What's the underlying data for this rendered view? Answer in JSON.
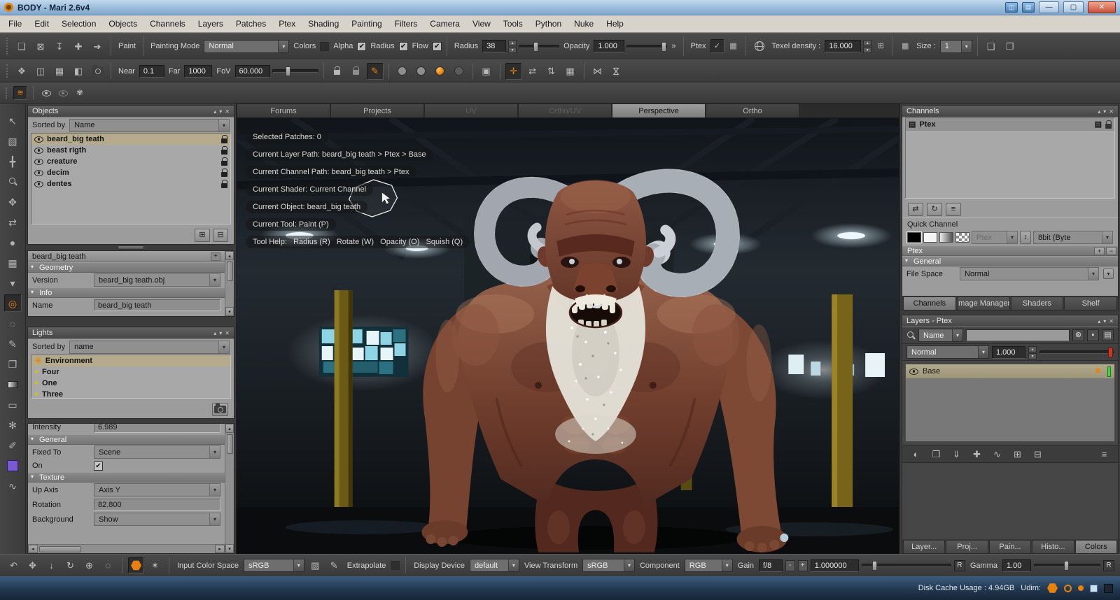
{
  "titlebar": {
    "title": "BODY - Mari 2.6v4"
  },
  "menubar": {
    "items": [
      "File",
      "Edit",
      "Selection",
      "Objects",
      "Channels",
      "Layers",
      "Patches",
      "Ptex",
      "Shading",
      "Painting",
      "Filters",
      "Camera",
      "View",
      "Tools",
      "Python",
      "Nuke",
      "Help"
    ]
  },
  "toolbar_paint": {
    "paint": "Paint",
    "painting_mode": "Painting Mode",
    "painting_mode_value": "Normal",
    "colors": "Colors",
    "alpha": "Alpha",
    "radius_toggle": "Radius",
    "flow": "Flow",
    "radius": "Radius",
    "radius_value": "38",
    "opacity": "Opacity",
    "opacity_value": "1.000",
    "overflow": "»",
    "ptex": "Ptex",
    "texel_density": "Texel density :",
    "texel_density_value": "16.000",
    "size": "Size :",
    "size_value": "1"
  },
  "toolbar_view": {
    "near": "Near",
    "near_value": "0.1",
    "far": "Far",
    "far_value": "1000",
    "fov": "FoV",
    "fov_value": "60.000"
  },
  "objects_panel": {
    "title": "Objects",
    "sorted_by": "Sorted by",
    "sort_value": "Name",
    "items": [
      {
        "name": "beard_big teath",
        "selected": true
      },
      {
        "name": "beast rigth"
      },
      {
        "name": "creature"
      },
      {
        "name": "decim"
      },
      {
        "name": "dentes"
      }
    ]
  },
  "object_props": {
    "title": "beard_big teath",
    "geometry": "Geometry",
    "version": "Version",
    "version_value": "beard_big teath.obj",
    "info": "Info",
    "name": "Name",
    "name_value": "beard_big teath"
  },
  "lights_panel": {
    "title": "Lights",
    "sorted_by": "Sorted by",
    "sort_value": "name",
    "items": [
      {
        "name": "Environment",
        "selected": true,
        "type": "env"
      },
      {
        "name": "Four"
      },
      {
        "name": "One"
      },
      {
        "name": "Three"
      }
    ]
  },
  "light_props": {
    "intensity": "Intensity",
    "intensity_value": "6.989",
    "general": "General",
    "fixed_to": "Fixed To",
    "fixed_to_value": "Scene",
    "on": "On",
    "texture": "Texture",
    "up_axis": "Up Axis",
    "up_axis_value": "Axis Y",
    "rotation": "Rotation",
    "rotation_value": "82.800",
    "background": "Background",
    "background_value": "Show"
  },
  "viewport": {
    "tabs": [
      {
        "label": "Forums"
      },
      {
        "label": "Projects"
      },
      {
        "label": "UV",
        "disabled": true
      },
      {
        "label": "Ortho/UV",
        "disabled": true
      },
      {
        "label": "Perspective",
        "active": true
      },
      {
        "label": "Ortho"
      }
    ],
    "hud": [
      {
        "text": "Selected Patches: 0"
      },
      {
        "text": "Current Layer Path: beard_big teath > Ptex > Base"
      },
      {
        "text": "Current Channel Path: beard_big teath > Ptex"
      },
      {
        "text": "Current Shader: Current Channel"
      },
      {
        "text": "Current Object: beard_big teath"
      },
      {
        "text": "Current Tool: Paint (P)"
      },
      {
        "text": "Tool Help:   Radius (R)   Rotate (W)   Opacity (O)   Squish (Q)"
      }
    ]
  },
  "channels_panel": {
    "title": "Channels",
    "items": [
      {
        "name": "Ptex",
        "selected": true
      }
    ],
    "quick_channel": "Quick Channel",
    "quick_name_value": "Ptex",
    "depth_value": "8bit (Byte",
    "section_title": "Ptex",
    "general": "General",
    "file_space": "File Space",
    "file_space_value": "Normal",
    "tabs": [
      {
        "label": "Channels",
        "active": true
      },
      {
        "label": "Image Manager"
      },
      {
        "label": "Shaders"
      },
      {
        "label": "Shelf"
      }
    ]
  },
  "layers_panel": {
    "title": "Layers - Ptex",
    "filter_field": "Name",
    "blend_mode": "Normal",
    "opacity_value": "1.000",
    "layers": [
      {
        "name": "Base",
        "selected": true
      }
    ],
    "tabs": [
      {
        "label": "Layer..."
      },
      {
        "label": "Proj..."
      },
      {
        "label": "Pain..."
      },
      {
        "label": "Histo..."
      },
      {
        "label": "Colors",
        "active": true
      }
    ]
  },
  "bottom_bar": {
    "input_color_space": "Input Color Space",
    "input_color_space_value": "sRGB",
    "extrapolate": "Extrapolate",
    "display_device": "Display Device",
    "display_device_value": "default",
    "view_transform": "View Transform",
    "view_transform_value": "sRGB",
    "component": "Component",
    "component_value": "RGB",
    "gain": "Gain",
    "gain_fstop": "f/8",
    "minus": "-",
    "plus": "+",
    "gain_value": "1.000000",
    "reset1": "R",
    "gamma": "Gamma",
    "gamma_value": "1.00",
    "reset2": "R"
  },
  "status_bar": {
    "disk_cache": "Disk Cache Usage : 4.94GB",
    "udim": "Udim:"
  },
  "colors": {
    "accent_orange": "#e8820e",
    "selection_tan": "#b5ab8c",
    "cache_green": "#3ad83a"
  }
}
